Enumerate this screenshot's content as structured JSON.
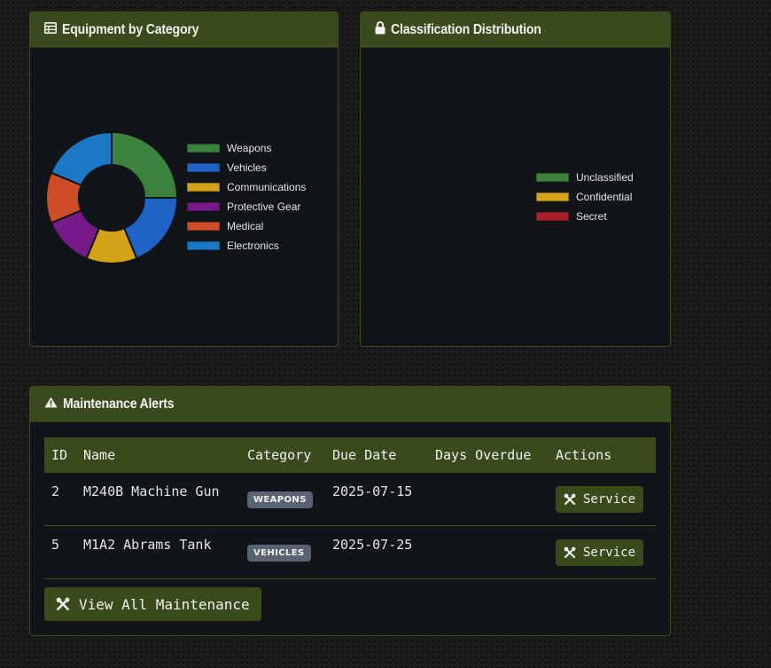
{
  "equipment_card": {
    "title": "Equipment by Category",
    "icon": "table-icon"
  },
  "classification_card": {
    "title": "Classification Distribution",
    "icon": "lock-icon"
  },
  "maintenance_card": {
    "title": "Maintenance Alerts",
    "icon": "warning-icon",
    "columns": [
      "ID",
      "Name",
      "Category",
      "Due Date",
      "Days Overdue",
      "Actions"
    ],
    "rows": [
      {
        "id": "2",
        "name": "M240B Machine Gun",
        "category": "WEAPONS",
        "due_date": "2025-07-15",
        "days_overdue": "",
        "action": "Service"
      },
      {
        "id": "5",
        "name": "M1A2 Abrams Tank",
        "category": "VEHICLES",
        "due_date": "2025-07-25",
        "days_overdue": "",
        "action": "Service"
      }
    ],
    "view_all_label": "View All Maintenance"
  },
  "chart_data": [
    {
      "type": "pie",
      "variant": "doughnut",
      "categories": [
        "Weapons",
        "Vehicles",
        "Communications",
        "Protective Gear",
        "Medical",
        "Electronics"
      ],
      "values": [
        2,
        1.5,
        1,
        1,
        1,
        1.5
      ],
      "colors": [
        "#3c823c",
        "#1f63c6",
        "#d3a217",
        "#751a88",
        "#cc4d26",
        "#1b78c5"
      ],
      "legend": "right"
    },
    {
      "type": "pie",
      "categories": [
        "Unclassified",
        "Confidential",
        "Secret"
      ],
      "values": [],
      "colors": [
        "#3c823c",
        "#d3a217",
        "#a9202b"
      ],
      "legend": "right"
    }
  ]
}
